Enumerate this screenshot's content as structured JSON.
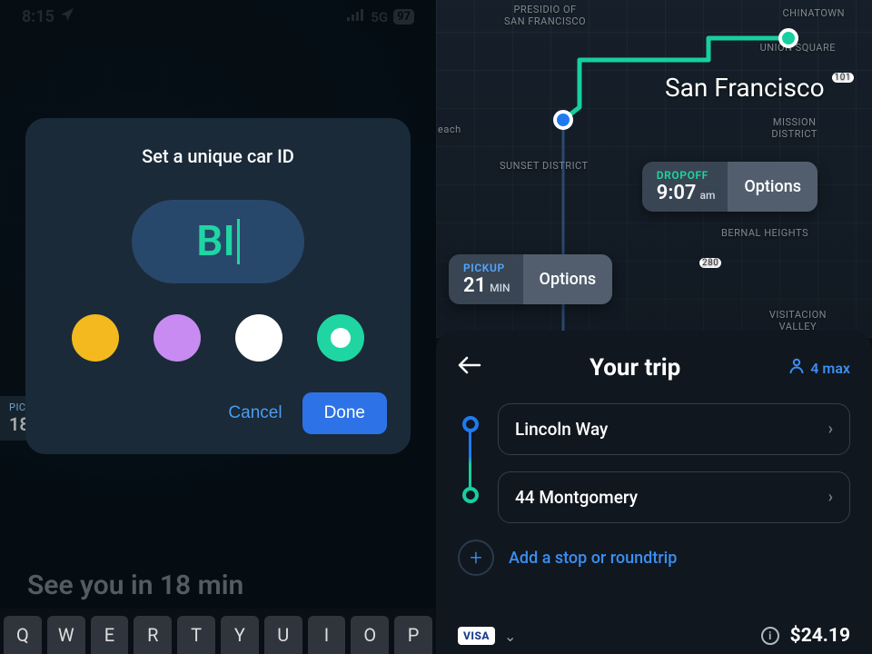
{
  "status_bar": {
    "time": "8:15",
    "network": "5G",
    "battery": "97"
  },
  "left_panel": {
    "pickup_chip": {
      "label": "PICKUP",
      "value": "18"
    },
    "see_you": "See you in 18 min",
    "modal": {
      "title": "Set a unique car ID",
      "input_value": "BI",
      "colors": {
        "yellow": "#f3b91f",
        "purple": "#c78bf2",
        "white": "#ffffff",
        "green": "#1fd6a2"
      },
      "cancel_label": "Cancel",
      "done_label": "Done"
    },
    "keyboard_row": [
      "Q",
      "W",
      "E",
      "R",
      "T",
      "Y",
      "U",
      "I",
      "O",
      "P"
    ]
  },
  "right_panel": {
    "city": "San Francisco",
    "map_labels": {
      "presidio": "PRESIDIO OF\nSAN FRANCISCO",
      "chinatown": "CHINATOWN",
      "union_square": "UNION SQUARE",
      "mission": "MISSION\nDISTRICT",
      "sunset": "SUNSET DISTRICT",
      "bernal": "BERNAL HEIGHTS",
      "visitacion": "VISITACION\nVALLEY",
      "beach": "each",
      "hwy101": "101",
      "hwy280": "280"
    },
    "dropoff": {
      "label": "DROPOFF",
      "time": "9:07",
      "unit": "am",
      "options": "Options"
    },
    "pickup": {
      "label": "PICKUP",
      "time": "21",
      "unit": "MIN",
      "options": "Options"
    },
    "sheet": {
      "title": "Your trip",
      "passengers": "4 max",
      "stops": [
        {
          "label": "Lincoln Way"
        },
        {
          "label": "44 Montgomery"
        }
      ],
      "add_stop": "Add a stop or roundtrip",
      "payment_brand": "VISA",
      "price": "$24.19"
    }
  }
}
